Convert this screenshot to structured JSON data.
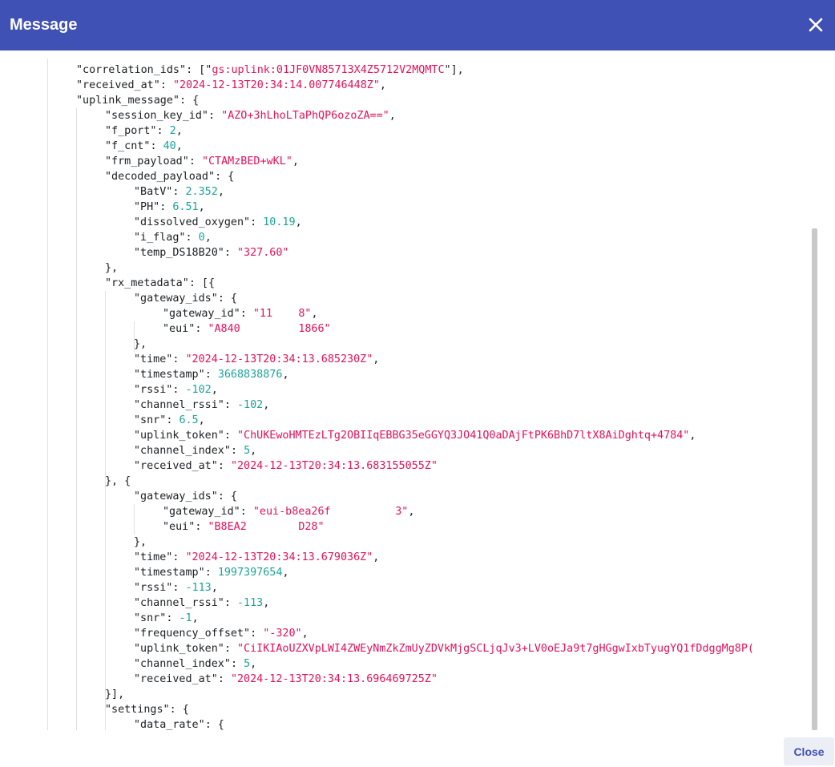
{
  "dialog": {
    "title": "Message",
    "close_label": "Close"
  },
  "json_lines": [
    {
      "indent": 1,
      "tokens": [
        [
          "k",
          "\"correlation_ids\""
        ],
        [
          "p",
          ": [\""
        ],
        [
          "s",
          "gs:uplink:01JF0VN85713X4Z5712V2MQMTC"
        ],
        [
          "p",
          "\"],"
        ]
      ]
    },
    {
      "indent": 1,
      "tokens": [
        [
          "k",
          "\"received_at\""
        ],
        [
          "p",
          ": "
        ],
        [
          "s",
          "\"2024-12-13T20:34:14.007746448Z\""
        ],
        [
          "p",
          ","
        ]
      ]
    },
    {
      "indent": 1,
      "tokens": [
        [
          "k",
          "\"uplink_message\""
        ],
        [
          "p",
          ": {"
        ]
      ]
    },
    {
      "indent": 2,
      "tokens": [
        [
          "k",
          "\"session_key_id\""
        ],
        [
          "p",
          ": "
        ],
        [
          "s",
          "\"AZO+3hLhoLTaPhQP6ozoZA==\""
        ],
        [
          "p",
          ","
        ]
      ]
    },
    {
      "indent": 2,
      "tokens": [
        [
          "k",
          "\"f_port\""
        ],
        [
          "p",
          ": "
        ],
        [
          "n",
          "2"
        ],
        [
          "p",
          ","
        ]
      ]
    },
    {
      "indent": 2,
      "tokens": [
        [
          "k",
          "\"f_cnt\""
        ],
        [
          "p",
          ": "
        ],
        [
          "n",
          "40"
        ],
        [
          "p",
          ","
        ]
      ]
    },
    {
      "indent": 2,
      "tokens": [
        [
          "k",
          "\"frm_payload\""
        ],
        [
          "p",
          ": "
        ],
        [
          "s",
          "\"CTAMzBED+wKL\""
        ],
        [
          "p",
          ","
        ]
      ]
    },
    {
      "indent": 2,
      "tokens": [
        [
          "k",
          "\"decoded_payload\""
        ],
        [
          "p",
          ": {"
        ]
      ]
    },
    {
      "indent": 3,
      "tokens": [
        [
          "k",
          "\"BatV\""
        ],
        [
          "p",
          ": "
        ],
        [
          "n",
          "2.352"
        ],
        [
          "p",
          ","
        ]
      ]
    },
    {
      "indent": 3,
      "tokens": [
        [
          "k",
          "\"PH\""
        ],
        [
          "p",
          ": "
        ],
        [
          "n",
          "6.51"
        ],
        [
          "p",
          ","
        ]
      ]
    },
    {
      "indent": 3,
      "tokens": [
        [
          "k",
          "\"dissolved_oxygen\""
        ],
        [
          "p",
          ": "
        ],
        [
          "n",
          "10.19"
        ],
        [
          "p",
          ","
        ]
      ]
    },
    {
      "indent": 3,
      "tokens": [
        [
          "k",
          "\"i_flag\""
        ],
        [
          "p",
          ": "
        ],
        [
          "n",
          "0"
        ],
        [
          "p",
          ","
        ]
      ]
    },
    {
      "indent": 3,
      "tokens": [
        [
          "k",
          "\"temp_DS18B20\""
        ],
        [
          "p",
          ": "
        ],
        [
          "s",
          "\"327.60\""
        ]
      ]
    },
    {
      "indent": 2,
      "tokens": [
        [
          "p",
          "},"
        ]
      ]
    },
    {
      "indent": 2,
      "tokens": [
        [
          "k",
          "\"rx_metadata\""
        ],
        [
          "p",
          ": [{"
        ]
      ]
    },
    {
      "indent": 3,
      "tokens": [
        [
          "k",
          "\"gateway_ids\""
        ],
        [
          "p",
          ": {"
        ]
      ]
    },
    {
      "indent": 4,
      "tokens": [
        [
          "k",
          "\"gateway_id\""
        ],
        [
          "p",
          ": "
        ],
        [
          "s",
          "\"11"
        ],
        [
          "p",
          "    "
        ],
        [
          "s",
          "8\""
        ],
        [
          "p",
          ","
        ]
      ]
    },
    {
      "indent": 4,
      "tokens": [
        [
          "k",
          "\"eui\""
        ],
        [
          "p",
          ": "
        ],
        [
          "s",
          "\"A840"
        ],
        [
          "p",
          "         "
        ],
        [
          "s",
          "1866\""
        ]
      ]
    },
    {
      "indent": 3,
      "tokens": [
        [
          "p",
          "},"
        ]
      ]
    },
    {
      "indent": 3,
      "tokens": [
        [
          "k",
          "\"time\""
        ],
        [
          "p",
          ": "
        ],
        [
          "s",
          "\"2024-12-13T20:34:13.685230Z\""
        ],
        [
          "p",
          ","
        ]
      ]
    },
    {
      "indent": 3,
      "tokens": [
        [
          "k",
          "\"timestamp\""
        ],
        [
          "p",
          ": "
        ],
        [
          "n",
          "3668838876"
        ],
        [
          "p",
          ","
        ]
      ]
    },
    {
      "indent": 3,
      "tokens": [
        [
          "k",
          "\"rssi\""
        ],
        [
          "p",
          ": "
        ],
        [
          "n",
          "-102"
        ],
        [
          "p",
          ","
        ]
      ]
    },
    {
      "indent": 3,
      "tokens": [
        [
          "k",
          "\"channel_rssi\""
        ],
        [
          "p",
          ": "
        ],
        [
          "n",
          "-102"
        ],
        [
          "p",
          ","
        ]
      ]
    },
    {
      "indent": 3,
      "tokens": [
        [
          "k",
          "\"snr\""
        ],
        [
          "p",
          ": "
        ],
        [
          "n",
          "6.5"
        ],
        [
          "p",
          ","
        ]
      ]
    },
    {
      "indent": 3,
      "tokens": [
        [
          "k",
          "\"uplink_token\""
        ],
        [
          "p",
          ": "
        ],
        [
          "s",
          "\"ChUKEwoHMTEzLTg2OBIIqEBBG35eGGYQ3JO41Q0aDAjFtPK6BhD7ltX8AiDghtq+4784\""
        ],
        [
          "p",
          ","
        ]
      ]
    },
    {
      "indent": 3,
      "tokens": [
        [
          "k",
          "\"channel_index\""
        ],
        [
          "p",
          ": "
        ],
        [
          "n",
          "5"
        ],
        [
          "p",
          ","
        ]
      ]
    },
    {
      "indent": 3,
      "tokens": [
        [
          "k",
          "\"received_at\""
        ],
        [
          "p",
          ": "
        ],
        [
          "s",
          "\"2024-12-13T20:34:13.683155055Z\""
        ]
      ]
    },
    {
      "indent": 2,
      "tokens": [
        [
          "p",
          "}, {"
        ]
      ]
    },
    {
      "indent": 3,
      "tokens": [
        [
          "k",
          "\"gateway_ids\""
        ],
        [
          "p",
          ": {"
        ]
      ]
    },
    {
      "indent": 4,
      "tokens": [
        [
          "k",
          "\"gateway_id\""
        ],
        [
          "p",
          ": "
        ],
        [
          "s",
          "\"eui-b8ea26f"
        ],
        [
          "p",
          "          "
        ],
        [
          "s",
          "3\""
        ],
        [
          "p",
          ","
        ]
      ]
    },
    {
      "indent": 4,
      "tokens": [
        [
          "k",
          "\"eui\""
        ],
        [
          "p",
          ": "
        ],
        [
          "s",
          "\"B8EA2"
        ],
        [
          "p",
          "        "
        ],
        [
          "s",
          "D28\""
        ]
      ]
    },
    {
      "indent": 3,
      "tokens": [
        [
          "p",
          "},"
        ]
      ]
    },
    {
      "indent": 3,
      "tokens": [
        [
          "k",
          "\"time\""
        ],
        [
          "p",
          ": "
        ],
        [
          "s",
          "\"2024-12-13T20:34:13.679036Z\""
        ],
        [
          "p",
          ","
        ]
      ]
    },
    {
      "indent": 3,
      "tokens": [
        [
          "k",
          "\"timestamp\""
        ],
        [
          "p",
          ": "
        ],
        [
          "n",
          "1997397654"
        ],
        [
          "p",
          ","
        ]
      ]
    },
    {
      "indent": 3,
      "tokens": [
        [
          "k",
          "\"rssi\""
        ],
        [
          "p",
          ": "
        ],
        [
          "n",
          "-113"
        ],
        [
          "p",
          ","
        ]
      ]
    },
    {
      "indent": 3,
      "tokens": [
        [
          "k",
          "\"channel_rssi\""
        ],
        [
          "p",
          ": "
        ],
        [
          "n",
          "-113"
        ],
        [
          "p",
          ","
        ]
      ]
    },
    {
      "indent": 3,
      "tokens": [
        [
          "k",
          "\"snr\""
        ],
        [
          "p",
          ": "
        ],
        [
          "n",
          "-1"
        ],
        [
          "p",
          ","
        ]
      ]
    },
    {
      "indent": 3,
      "tokens": [
        [
          "k",
          "\"frequency_offset\""
        ],
        [
          "p",
          ": "
        ],
        [
          "s",
          "\"-320\""
        ],
        [
          "p",
          ","
        ]
      ]
    },
    {
      "indent": 3,
      "tokens": [
        [
          "k",
          "\"uplink_token\""
        ],
        [
          "p",
          ": "
        ],
        [
          "s",
          "\"CiIKIAoUZXVpLWI4ZWEyNmZkZmUyZDVkMjgSCLjqJv3+LV0oEJa9t7gHGgwIxbTyugYQ1fDdggMg8P("
        ]
      ]
    },
    {
      "indent": 3,
      "tokens": [
        [
          "k",
          "\"channel_index\""
        ],
        [
          "p",
          ": "
        ],
        [
          "n",
          "5"
        ],
        [
          "p",
          ","
        ]
      ]
    },
    {
      "indent": 3,
      "tokens": [
        [
          "k",
          "\"received_at\""
        ],
        [
          "p",
          ": "
        ],
        [
          "s",
          "\"2024-12-13T20:34:13.696469725Z\""
        ]
      ]
    },
    {
      "indent": 2,
      "tokens": [
        [
          "p",
          "}],"
        ]
      ]
    },
    {
      "indent": 2,
      "tokens": [
        [
          "k",
          "\"settings\""
        ],
        [
          "p",
          ": {"
        ]
      ]
    },
    {
      "indent": 3,
      "tokens": [
        [
          "k",
          "\"data_rate\""
        ],
        [
          "p",
          ": {"
        ]
      ]
    }
  ]
}
